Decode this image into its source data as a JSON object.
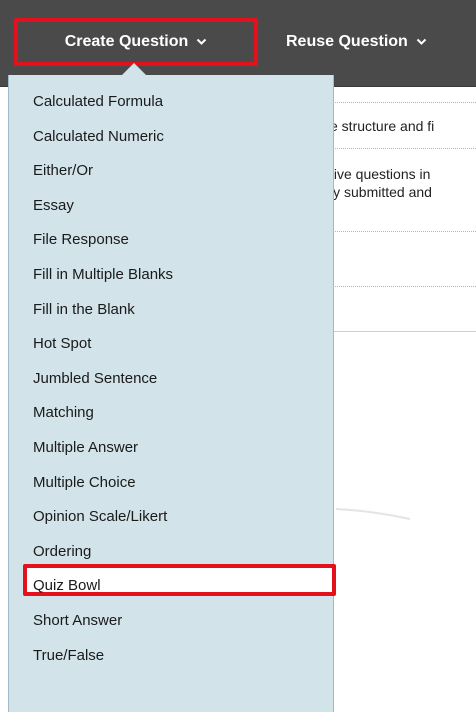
{
  "toolbar": {
    "create_label": "Create Question",
    "reuse_label": "Reuse Question"
  },
  "content": {
    "line1": "e structure and fi",
    "line2": "tive questions in",
    "line3": "ly submitted and"
  },
  "menu": {
    "items": [
      "Calculated Formula",
      "Calculated Numeric",
      "Either/Or",
      "Essay",
      "File Response",
      "Fill in Multiple Blanks",
      "Fill in the Blank",
      "Hot Spot",
      "Jumbled Sentence",
      "Matching",
      "Multiple Answer",
      "Multiple Choice",
      "Opinion Scale/Likert",
      "Ordering",
      "Quiz Bowl",
      "Short Answer",
      "True/False"
    ],
    "highlighted": "Multiple Choice"
  },
  "colors": {
    "toolbar_bg": "#4a4a4a",
    "menu_bg": "#d2e3ea",
    "highlight_border": "#e3111b"
  },
  "icons": [
    "chevron-down-icon"
  ]
}
